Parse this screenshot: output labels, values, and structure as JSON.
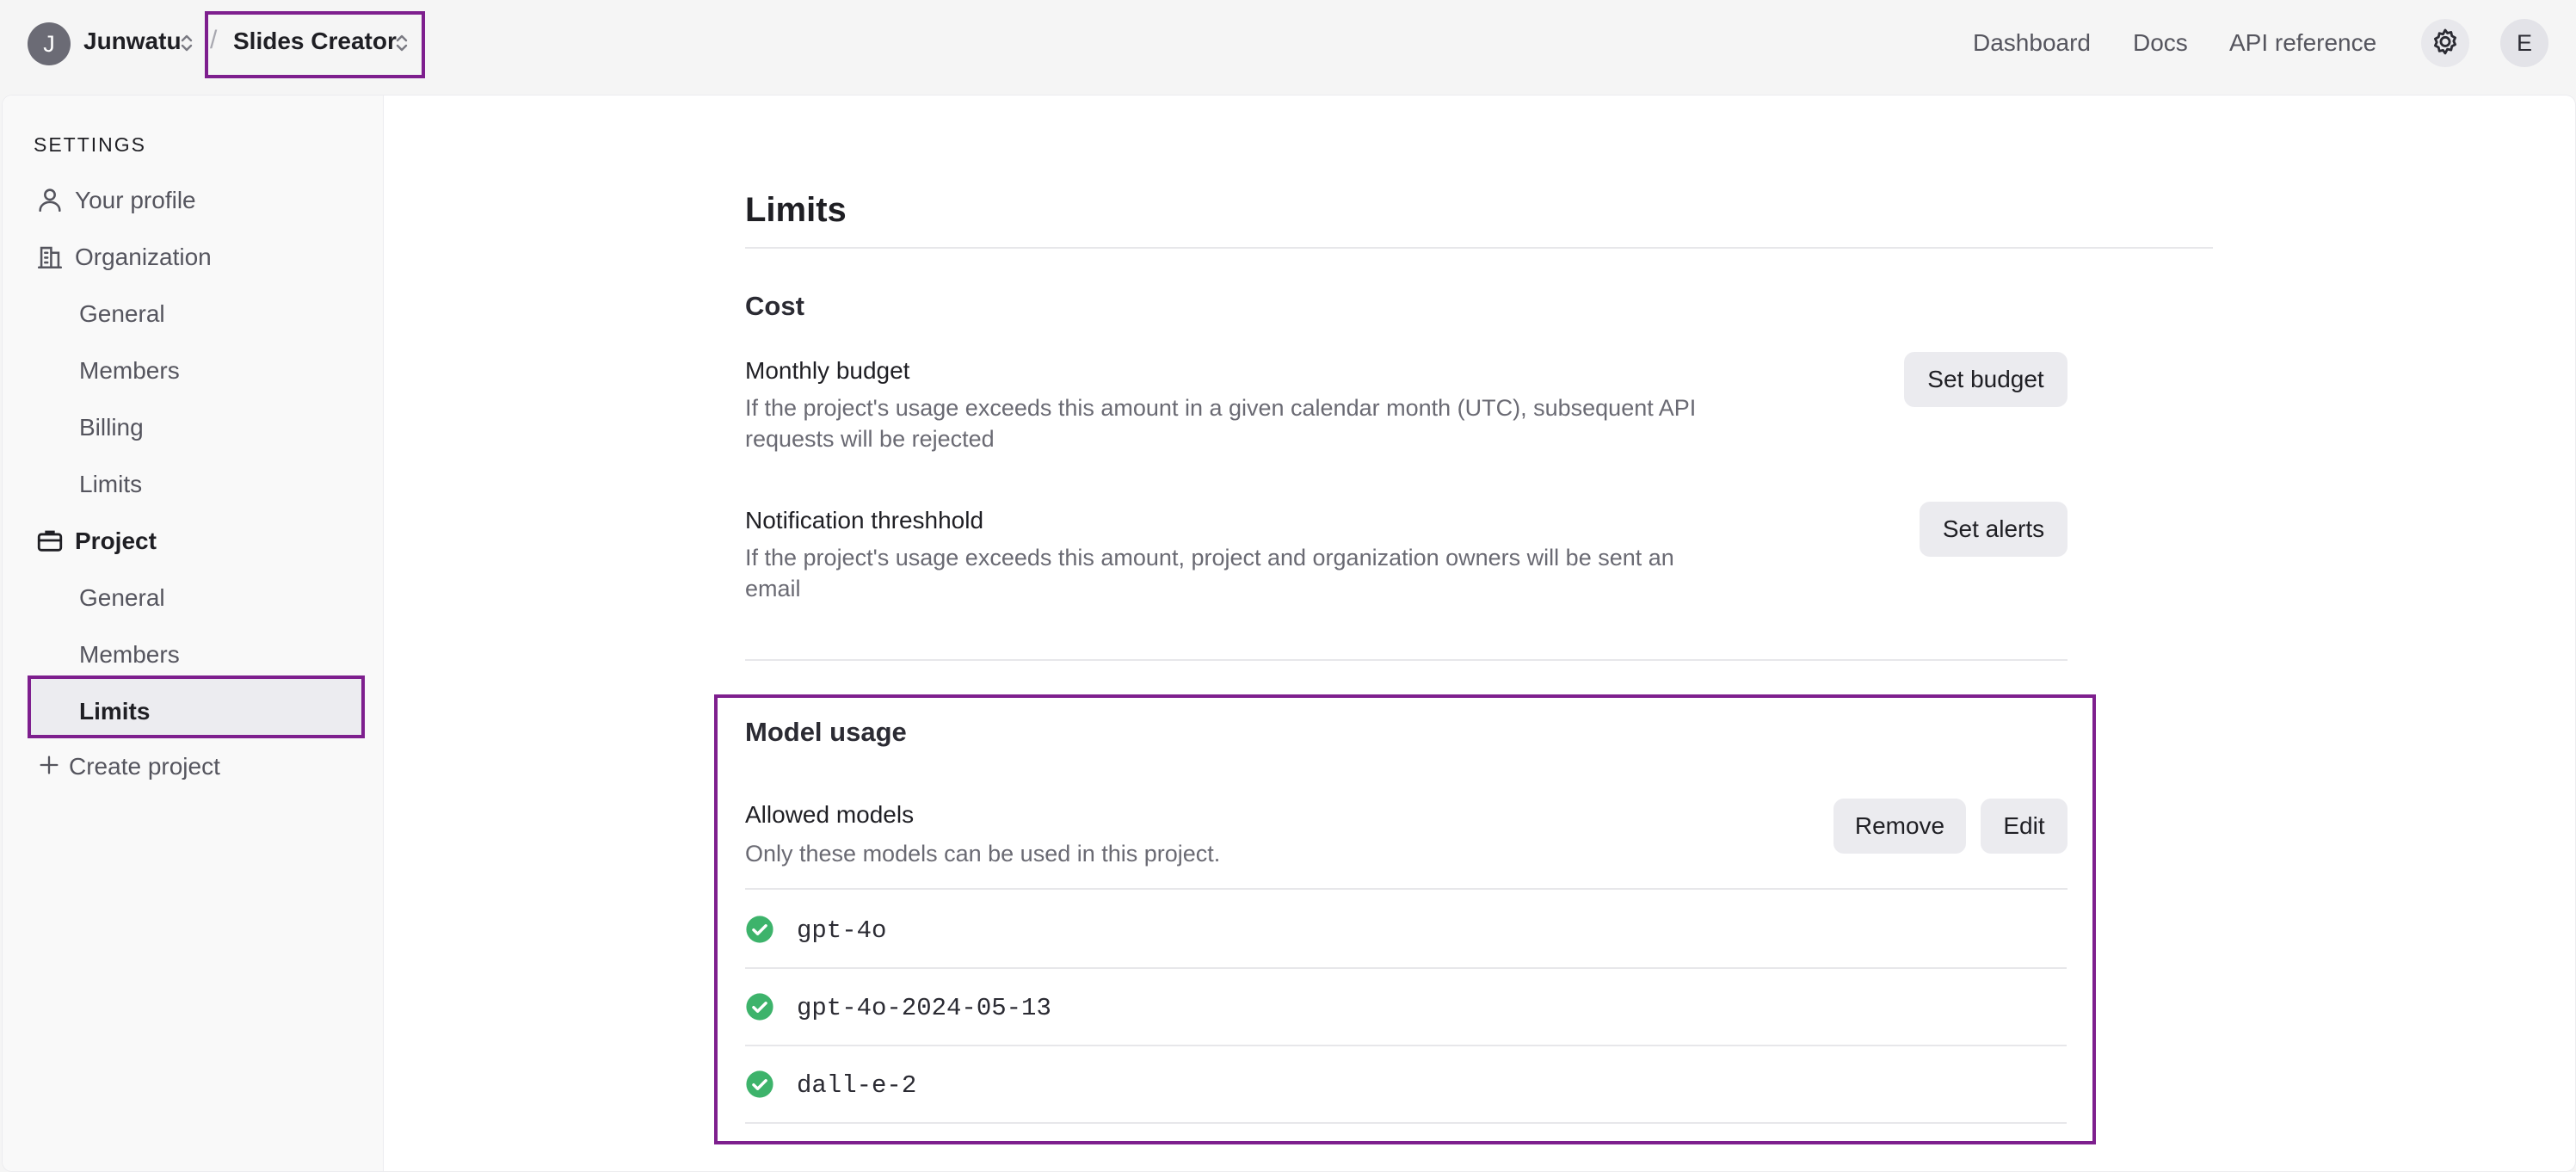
{
  "header": {
    "org_initial": "J",
    "org_name": "Junwatu",
    "separator": "/",
    "project_name": "Slides Creator",
    "nav": [
      "Dashboard",
      "Docs",
      "API reference"
    ],
    "user_initial": "E",
    "icons": {
      "switcher": "chevron-up-down-icon",
      "settings": "gear-icon"
    }
  },
  "sidebar": {
    "heading": "SETTINGS",
    "profile": "Your profile",
    "organization": "Organization",
    "org_items": [
      "General",
      "Members",
      "Billing",
      "Limits"
    ],
    "project": "Project",
    "project_items": [
      "General",
      "Members",
      "Limits"
    ],
    "active_item": "Limits",
    "create_project": "Create project",
    "icons": {
      "profile": "person-icon",
      "organization": "building-icon",
      "project": "briefcase-icon",
      "create": "plus-icon"
    }
  },
  "main": {
    "title": "Limits",
    "cost": {
      "title": "Cost",
      "monthly_budget": {
        "title": "Monthly budget",
        "description": "If the project's usage exceeds this amount in a given calendar month (UTC), subsequent API requests will be rejected",
        "button": "Set budget"
      },
      "notification": {
        "title": "Notification threshhold",
        "description": "If the project's usage exceeds this amount, project and organization owners will be sent an email",
        "button": "Set alerts"
      }
    },
    "model_usage": {
      "title": "Model usage",
      "allowed_title": "Allowed models",
      "allowed_desc": "Only these models can be used in this project.",
      "remove_button": "Remove",
      "edit_button": "Edit",
      "models": [
        "gpt-4o",
        "gpt-4o-2024-05-13",
        "dall-e-2"
      ],
      "check_icon": "check-circle-icon"
    }
  },
  "colors": {
    "highlight": "#7e1f8e",
    "check": "#3db36b",
    "button_bg": "#ebebef"
  }
}
